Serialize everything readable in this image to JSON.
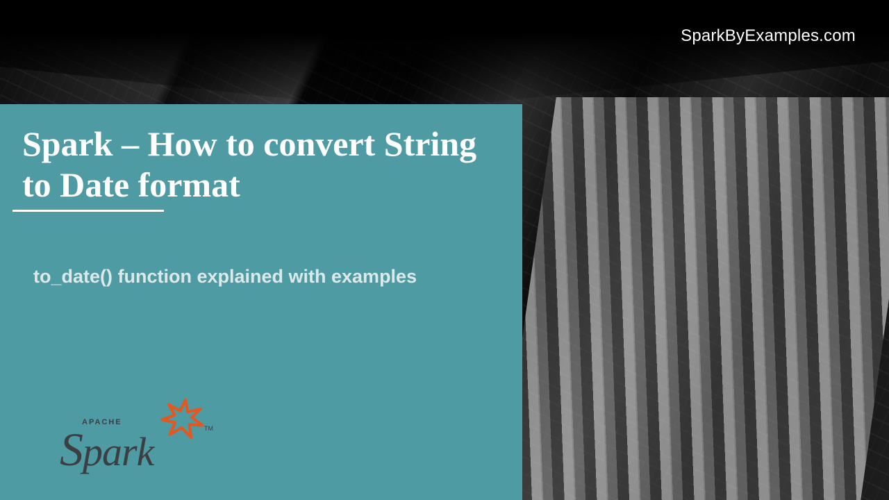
{
  "site": {
    "url_label": "SparkByExamples.com"
  },
  "panel": {
    "title": "Spark – How to convert String to Date format",
    "subtitle": "to_date() function explained with examples"
  },
  "logo": {
    "pretext": "APACHE",
    "name_html": "Spark",
    "tm": "TM",
    "star_color": "#e25822"
  }
}
